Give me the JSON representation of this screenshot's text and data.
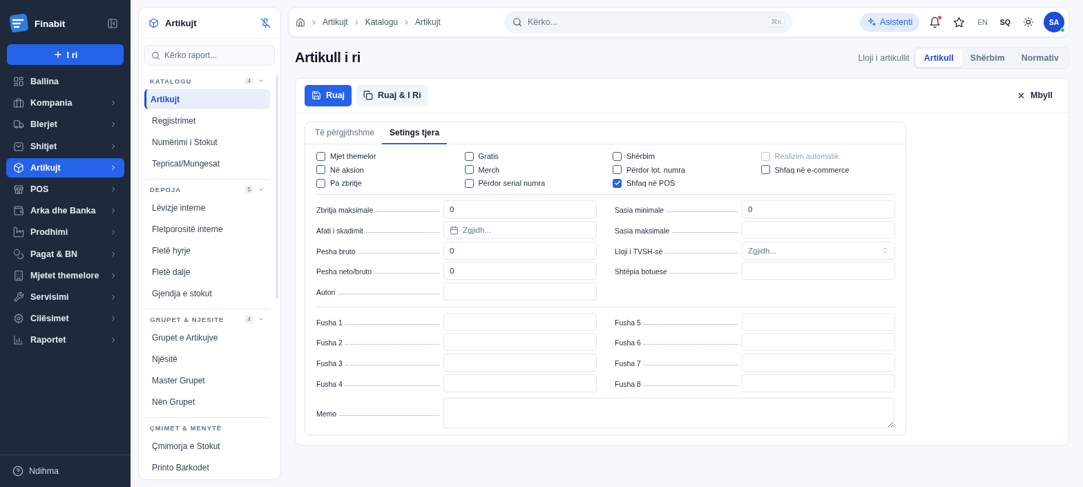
{
  "sidebar": {
    "brand": "Finabit",
    "new_button": "I ri",
    "items": [
      {
        "label": "Ballina",
        "selected": false,
        "submenu": false
      },
      {
        "label": "Kompania",
        "selected": false,
        "submenu": true
      },
      {
        "label": "Blerjet",
        "selected": false,
        "submenu": true
      },
      {
        "label": "Shitjet",
        "selected": false,
        "submenu": true
      },
      {
        "label": "Artikujt",
        "selected": true,
        "submenu": true
      },
      {
        "label": "POS",
        "selected": false,
        "submenu": true
      },
      {
        "label": "Arka dhe Banka",
        "selected": false,
        "submenu": true
      },
      {
        "label": "Prodhimi",
        "selected": false,
        "submenu": true
      },
      {
        "label": "Pagat & BN",
        "selected": false,
        "submenu": true
      },
      {
        "label": "Mjetet themelore",
        "selected": false,
        "submenu": true
      },
      {
        "label": "Servisimi",
        "selected": false,
        "submenu": true
      },
      {
        "label": "Cilësimet",
        "selected": false,
        "submenu": true
      },
      {
        "label": "Raportet",
        "selected": false,
        "submenu": true
      }
    ],
    "help": "Ndihma"
  },
  "panel": {
    "title": "Artikujt",
    "search": {
      "placeholder": "Kërko raport..."
    },
    "sections": [
      {
        "title": "KATALOGU",
        "count": "4",
        "expanded": true,
        "items": [
          {
            "label": "Artikujt",
            "selected": true
          },
          {
            "label": "Regjistrimet",
            "selected": false
          },
          {
            "label": "Numërimi i Stokut",
            "selected": false
          },
          {
            "label": "Tepricat/Mungesat",
            "selected": false
          }
        ]
      },
      {
        "title": "DEPOJA",
        "count": "5",
        "expanded": true,
        "items": [
          {
            "label": "Lëvizje interne",
            "selected": false
          },
          {
            "label": "Fletporositë interne",
            "selected": false
          },
          {
            "label": "Fletë hyrje",
            "selected": false
          },
          {
            "label": "Fletë dalje",
            "selected": false
          },
          {
            "label": "Gjendja e stokut",
            "selected": false
          }
        ]
      },
      {
        "title": "GRUPET & NJESITE",
        "count": "4",
        "expanded": true,
        "items": [
          {
            "label": "Grupet e Artikujve",
            "selected": false
          },
          {
            "label": "Njësitë",
            "selected": false
          },
          {
            "label": "Master Grupet",
            "selected": false
          },
          {
            "label": "Nën Grupet",
            "selected": false
          }
        ]
      },
      {
        "title": "ÇMIMET & MENYTË",
        "items": [
          {
            "label": "Çmimorja e Stokut",
            "selected": false
          },
          {
            "label": "Printo Barkodet",
            "selected": false
          }
        ]
      }
    ]
  },
  "topbar": {
    "breadcrumb": [
      "Artikujt",
      "Katalogu",
      "Artikujt"
    ],
    "search": {
      "placeholder": "Kërko...",
      "shortcut": "⌘K"
    },
    "assistant": "Asistenti",
    "has_unread": true,
    "languages": [
      {
        "label": "EN",
        "selected": false
      },
      {
        "label": "SQ",
        "selected": true
      }
    ],
    "avatar": "SA",
    "online": true
  },
  "page": {
    "title": "Artikull i ri",
    "type_label": "Lloji i artikullit",
    "types": [
      {
        "label": "Artikull",
        "selected": true
      },
      {
        "label": "Shërbim",
        "selected": false
      },
      {
        "label": "Normativ",
        "selected": false
      }
    ]
  },
  "toolbar": {
    "save": "Ruaj",
    "save_new": "Ruaj & I Ri",
    "close": "Mbyll"
  },
  "tabs": [
    {
      "label": "Të përgjithshme",
      "selected": false
    },
    {
      "label": "Setings tjera",
      "selected": true
    }
  ],
  "checkboxes": [
    {
      "label": "Mjet themelor",
      "checked": false,
      "disabled": false
    },
    {
      "label": "Gratis",
      "checked": false,
      "disabled": false
    },
    {
      "label": "Shërbim",
      "checked": false,
      "disabled": false
    },
    {
      "label": "Realizim automatik",
      "checked": false,
      "disabled": true
    },
    {
      "label": "Në aksion",
      "checked": false,
      "disabled": false
    },
    {
      "label": "Merch",
      "checked": false,
      "disabled": false
    },
    {
      "label": "Përdor lot. numra",
      "checked": false,
      "disabled": false
    },
    {
      "label": "Shfaq në e-commerce",
      "checked": false,
      "disabled": false
    },
    {
      "label": "Pa zbritje",
      "checked": false,
      "disabled": false
    },
    {
      "label": "Përdor serial numra",
      "checked": false,
      "disabled": false
    },
    {
      "label": "Shfaq në POS",
      "checked": true,
      "disabled": false
    }
  ],
  "fields_left": [
    {
      "label": "Zbritja maksimale",
      "kind": "text",
      "value": "0"
    },
    {
      "label": "Afati i skadimit",
      "kind": "date",
      "placeholder": "Zgjidh..."
    },
    {
      "label": "Pesha bruto",
      "kind": "text",
      "value": "0"
    },
    {
      "label": "Pesha neto/bruto",
      "kind": "text",
      "value": "0"
    },
    {
      "label": "Autori",
      "kind": "text"
    }
  ],
  "fields_right": [
    {
      "label": "Sasia minimale",
      "kind": "text",
      "value": "0"
    },
    {
      "label": "Sasia maksimale",
      "kind": "text"
    },
    {
      "label": "Lloji i TVSH-së",
      "kind": "select",
      "placeholder": "Zgjidh..."
    },
    {
      "label": "Shtëpia botuese",
      "kind": "text"
    }
  ],
  "custom_fields": [
    {
      "label": "Fusha 1"
    },
    {
      "label": "Fusha 2"
    },
    {
      "label": "Fusha 3"
    },
    {
      "label": "Fusha 4"
    },
    {
      "label": "Fusha 5"
    },
    {
      "label": "Fusha 6"
    },
    {
      "label": "Fusha 7"
    },
    {
      "label": "Fusha 8"
    }
  ],
  "memo": {
    "label": "Memo"
  }
}
